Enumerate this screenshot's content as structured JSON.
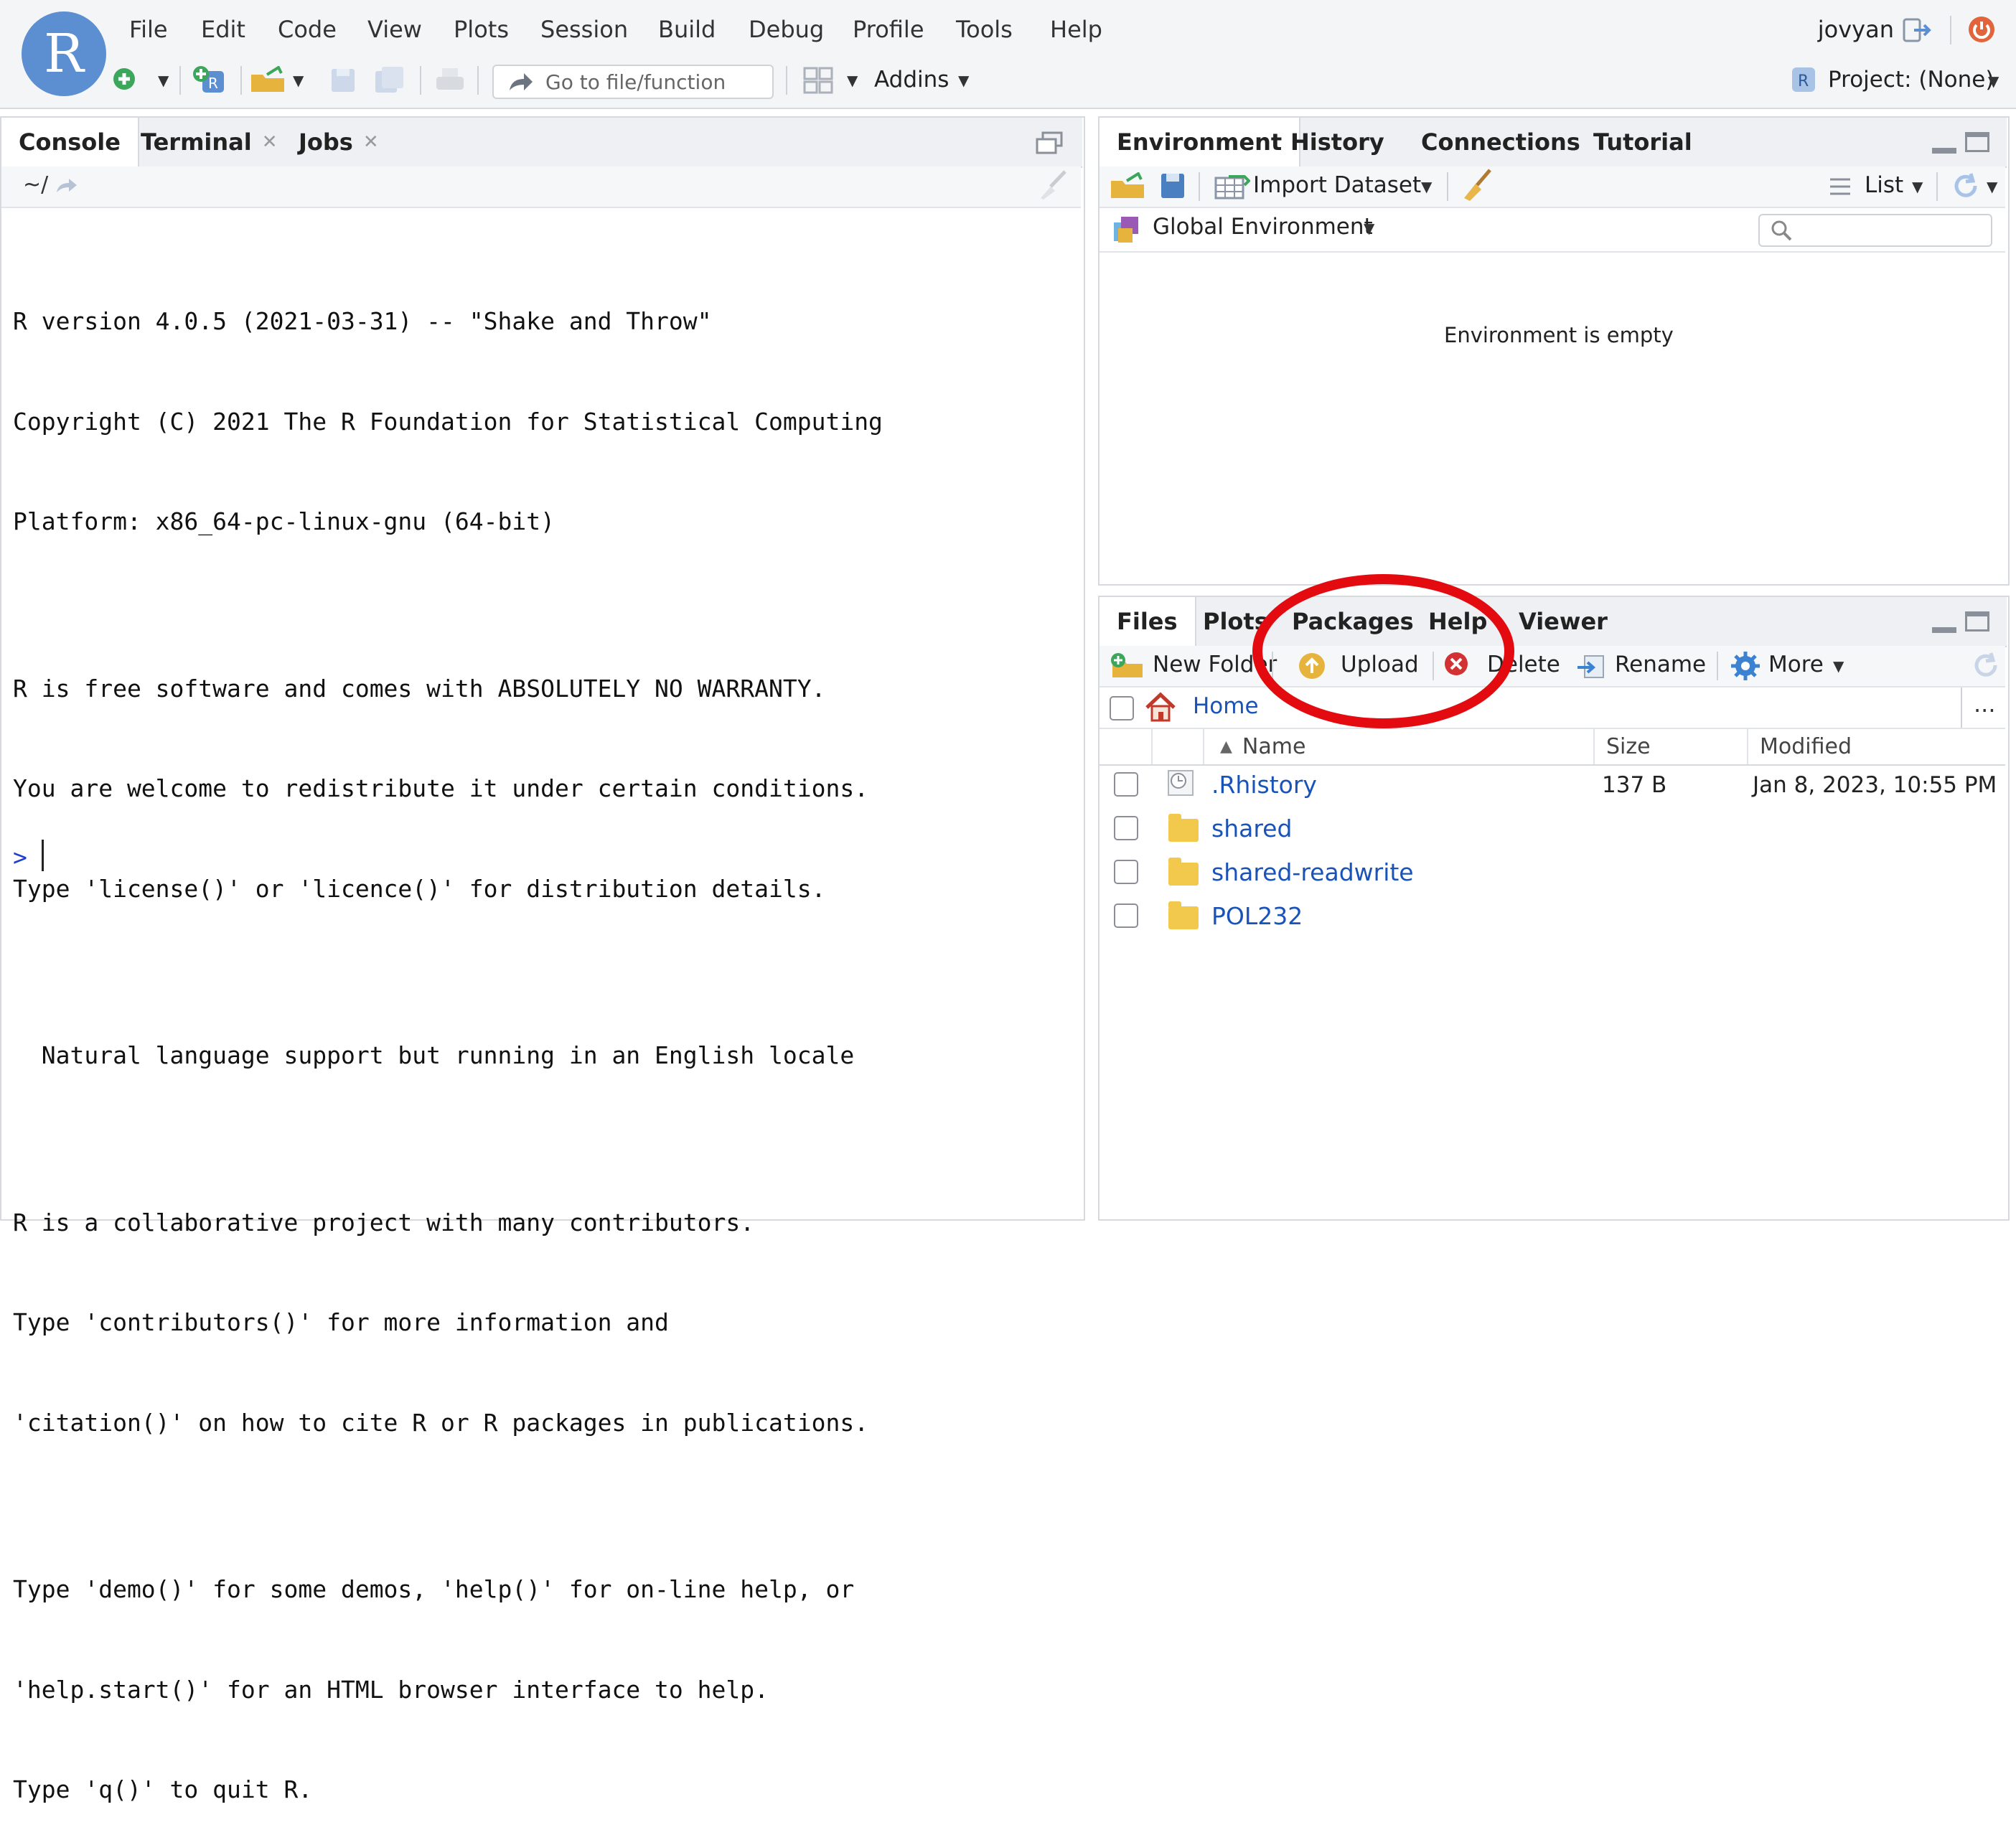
{
  "app": {
    "logo_letter": "R",
    "user": "jovyan"
  },
  "menu": [
    "File",
    "Edit",
    "Code",
    "View",
    "Plots",
    "Session",
    "Build",
    "Debug",
    "Profile",
    "Tools",
    "Help"
  ],
  "toolbar": {
    "goto_placeholder": "Go to file/function",
    "addins": "Addins",
    "project": "Project: (None)"
  },
  "console_pane": {
    "tabs": [
      "Console",
      "Terminal",
      "Jobs"
    ],
    "path": "~/",
    "lines": [
      "R version 4.0.5 (2021-03-31) -- \"Shake and Throw\"",
      "Copyright (C) 2021 The R Foundation for Statistical Computing",
      "Platform: x86_64-pc-linux-gnu (64-bit)",
      "",
      "R is free software and comes with ABSOLUTELY NO WARRANTY.",
      "You are welcome to redistribute it under certain conditions.",
      "Type 'license()' or 'licence()' for distribution details.",
      "",
      "  Natural language support but running in an English locale",
      "",
      "R is a collaborative project with many contributors.",
      "Type 'contributors()' for more information and",
      "'citation()' on how to cite R or R packages in publications.",
      "",
      "Type 'demo()' for some demos, 'help()' for on-line help, or",
      "'help.start()' for an HTML browser interface to help.",
      "Type 'q()' to quit R."
    ],
    "prompt": ">"
  },
  "env_pane": {
    "tabs": [
      "Environment",
      "History",
      "Connections",
      "Tutorial"
    ],
    "import_dataset": "Import Dataset",
    "list_view": "List",
    "scope": "Global Environment",
    "empty_message": "Environment is empty"
  },
  "files_pane": {
    "tabs": [
      "Files",
      "Plots",
      "Packages",
      "Help",
      "Viewer"
    ],
    "actions": {
      "new_folder": "New Folder",
      "upload": "Upload",
      "delete": "Delete",
      "rename": "Rename",
      "more": "More"
    },
    "breadcrumb": "Home",
    "columns": {
      "name": "Name",
      "size": "Size",
      "modified": "Modified"
    },
    "files": [
      {
        "name": ".Rhistory",
        "size": "137 B",
        "modified": "Jan 8, 2023, 10:55 PM",
        "kind": "file"
      },
      {
        "name": "shared",
        "size": "",
        "modified": "",
        "kind": "folder"
      },
      {
        "name": "shared-readwrite",
        "size": "",
        "modified": "",
        "kind": "folder"
      },
      {
        "name": "POL232",
        "size": "",
        "modified": "",
        "kind": "folder"
      }
    ],
    "more_dots": "..."
  },
  "colors": {
    "accent": "#1a53b8",
    "logo": "#5b8fd1",
    "highlight_ring": "#e30b10",
    "prompt": "#1f40c8"
  },
  "icons": [
    "new-file-icon",
    "new-project-icon",
    "open-folder-icon",
    "save-icon",
    "save-all-icon",
    "print-icon",
    "grid-icon",
    "power-icon",
    "logout-icon",
    "broom-icon",
    "refresh-icon",
    "gear-icon",
    "home-icon",
    "search-icon",
    "clock-icon"
  ]
}
